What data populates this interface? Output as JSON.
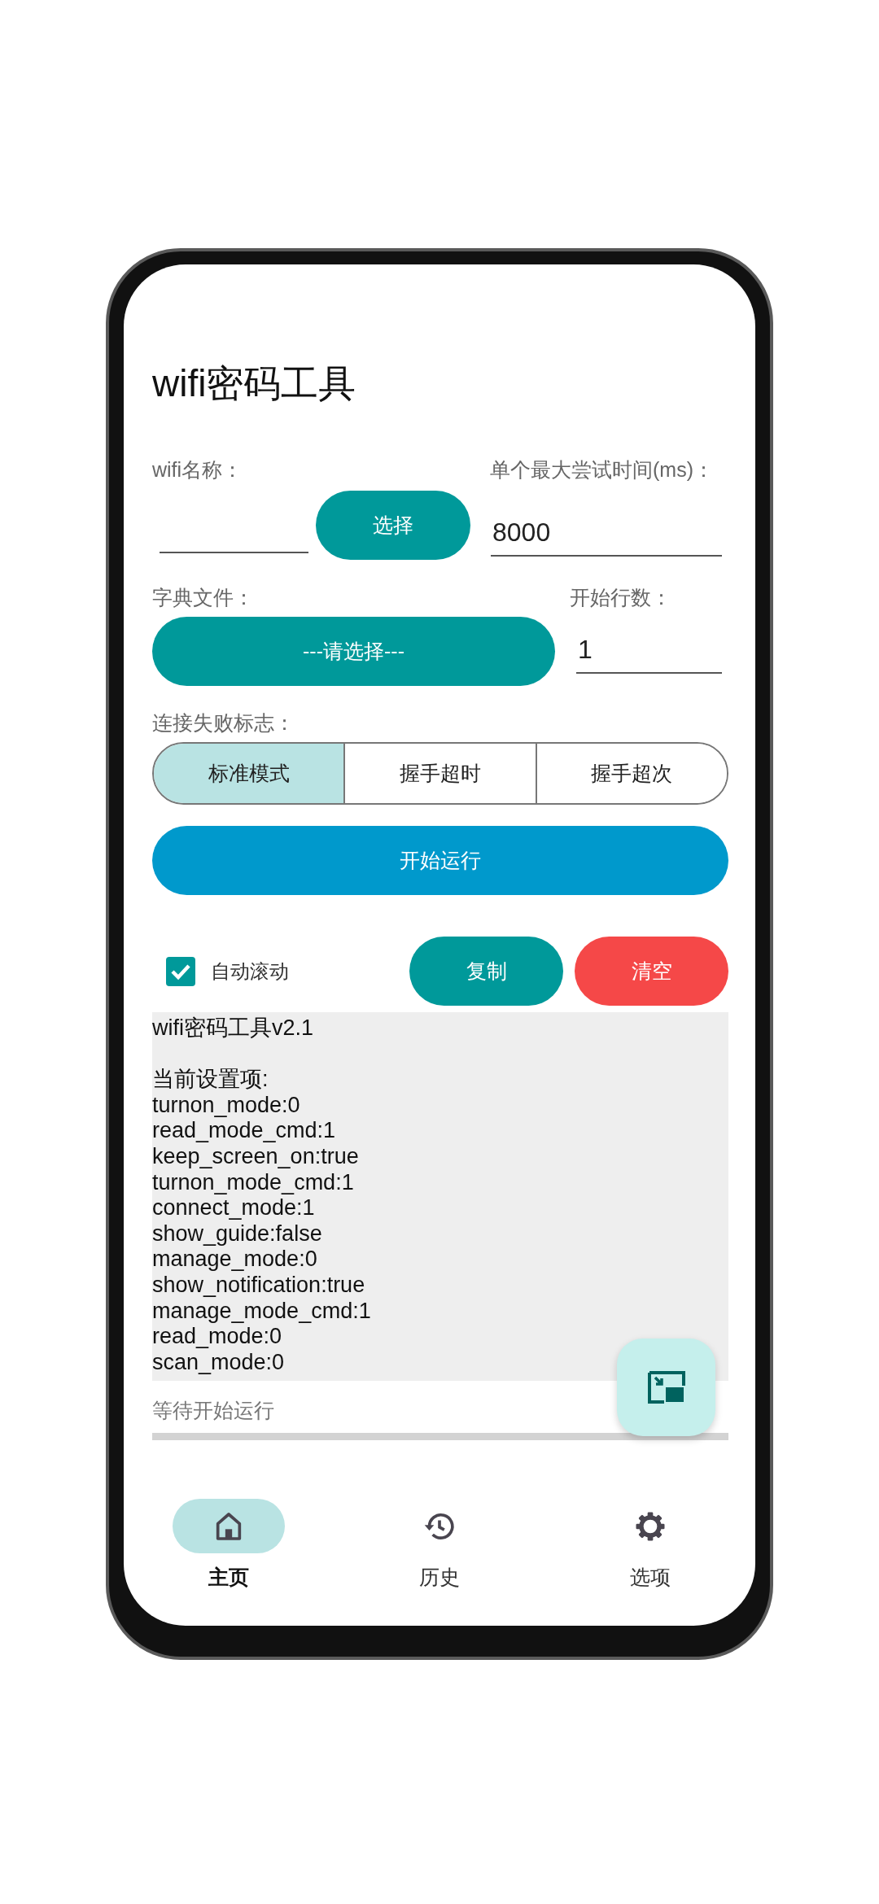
{
  "app_title": "wifi密码工具",
  "wifi_name": {
    "label": "wifi名称：",
    "button": "选择"
  },
  "timeout": {
    "label": "单个最大尝试时间(ms)：",
    "value": "8000"
  },
  "dictionary": {
    "label": "字典文件：",
    "button": "---请选择---"
  },
  "start_line": {
    "label": "开始行数：",
    "value": "1"
  },
  "fail_flag": {
    "label": "连接失败标志：",
    "options": [
      {
        "label": "标准模式",
        "selected": true
      },
      {
        "label": "握手超时",
        "selected": false
      },
      {
        "label": "握手超次",
        "selected": false
      }
    ]
  },
  "run_button": "开始运行",
  "auto_scroll": {
    "label": "自动滚动",
    "checked": true
  },
  "copy_button": "复制",
  "clear_button": "清空",
  "log": {
    "blocks": [
      [
        "wifi密码工具v2.1"
      ],
      [
        "当前设置项:",
        "turnon_mode:0",
        "read_mode_cmd:1",
        "keep_screen_on:true",
        "turnon_mode_cmd:1",
        "connect_mode:1",
        "show_guide:false",
        "manage_mode:0",
        "show_notification:true",
        "manage_mode_cmd:1",
        "read_mode:0",
        "scan_mode:0"
      ]
    ]
  },
  "status": "等待开始运行",
  "progress": {
    "level": 0
  },
  "nav": [
    {
      "label": "主页",
      "selected": true
    },
    {
      "label": "历史",
      "selected": false
    },
    {
      "label": "选项",
      "selected": false
    }
  ]
}
